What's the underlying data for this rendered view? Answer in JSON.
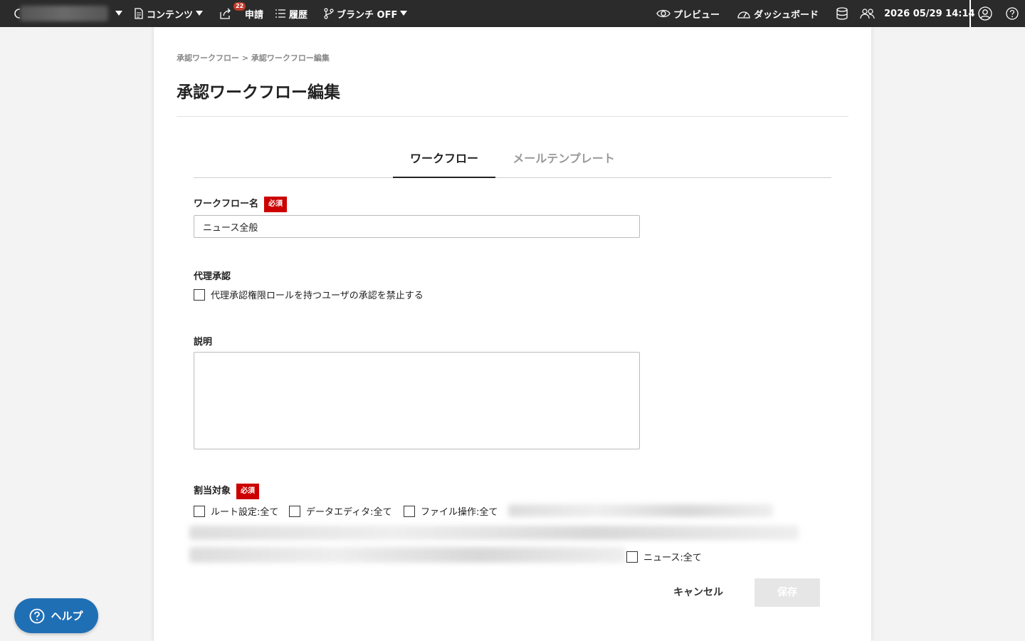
{
  "topbar": {
    "contents_label": "コンテンツ",
    "request_label": "申請",
    "request_badge": "22",
    "history_label": "履歴",
    "branch_label": "ブランチ OFF",
    "preview_label": "プレビュー",
    "dashboard_label": "ダッシュボード",
    "datetime": "2026 05/29 14:14"
  },
  "breadcrumb": "承認ワークフロー > 承認ワークフロー編集",
  "page_title": "承認ワークフロー編集",
  "tabs": [
    {
      "label": "ワークフロー",
      "active": true
    },
    {
      "label": "メールテンプレート",
      "active": false
    }
  ],
  "form": {
    "workflow_name_label": "ワークフロー名",
    "required_badge": "必須",
    "workflow_name_value": "ニュース全般",
    "proxy_label": "代理承認",
    "proxy_checkbox_label": "代理承認権限ロールを持つユーザの承認を禁止する",
    "description_label": "説明",
    "description_value": "",
    "assign_label": "割当対象",
    "assign_options": [
      "ルート設定:全て",
      "データエディタ:全て",
      "ファイル操作:全て",
      "ニュース:全て"
    ]
  },
  "actions": {
    "cancel_label": "キャンセル",
    "save_label": "保存"
  },
  "help_label": "ヘルプ",
  "colors": {
    "topbar_bg": "#2b2b2b",
    "required_badge_bg": "#cc0000",
    "help_button_bg": "#1f6fb5",
    "badge_bg": "#c0392b"
  }
}
